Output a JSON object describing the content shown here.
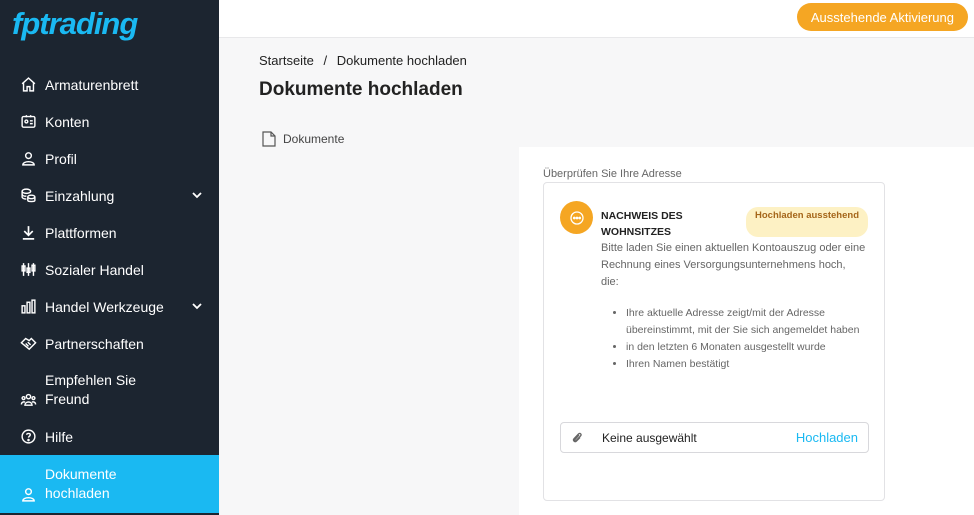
{
  "brand": {
    "logo_text": "fptrading",
    "color": "#1ab9f2"
  },
  "sidebar": {
    "items": [
      {
        "label": "Armaturenbrett",
        "icon": "home-icon"
      },
      {
        "label": "Konten",
        "icon": "id-card-icon"
      },
      {
        "label": "Profil",
        "icon": "user-icon"
      },
      {
        "label": "Einzahlung",
        "icon": "coins-icon",
        "expandable": true
      },
      {
        "label": "Plattformen",
        "icon": "download-icon"
      },
      {
        "label": "Sozialer Handel",
        "icon": "candlestick-icon"
      },
      {
        "label": "Handel Werkzeuge",
        "icon": "bar-chart-icon",
        "expandable": true
      },
      {
        "label": "Partnerschaften",
        "icon": "handshake-icon"
      },
      {
        "label": "Empfehlen Sie Freund",
        "icon": "users-icon"
      },
      {
        "label": "Hilfe",
        "icon": "help-icon"
      },
      {
        "label": "Dokumente hochladen",
        "icon": "user-icon",
        "active": true
      }
    ]
  },
  "topbar": {
    "activation_label": "Ausstehende Aktivierung",
    "activation_color": "#f5a623"
  },
  "breadcrumb": {
    "home": "Startseite",
    "separator": "/",
    "current": "Dokumente hochladen"
  },
  "page": {
    "title": "Dokumente hochladen"
  },
  "tabs": {
    "documents_label": "Dokumente"
  },
  "verify": {
    "section_label": "Überprüfen Sie Ihre Adresse",
    "card_title": "NACHWEIS DES WOHNSITZES",
    "status": "Hochladen ausstehend",
    "description": "Bitte laden Sie einen aktuellen Kontoauszug oder eine Rechnung eines Versorgungsunternehmens hoch, die:",
    "requirements": [
      "Ihre aktuelle Adresse zeigt/mit der Adresse übereinstimmt, mit der Sie sich angemeldet haben",
      "in den letzten 6 Monaten ausgestellt wurde",
      "Ihren Namen bestätigt"
    ],
    "file_placeholder": "Keine ausgewählt",
    "upload_label": "Hochladen"
  }
}
